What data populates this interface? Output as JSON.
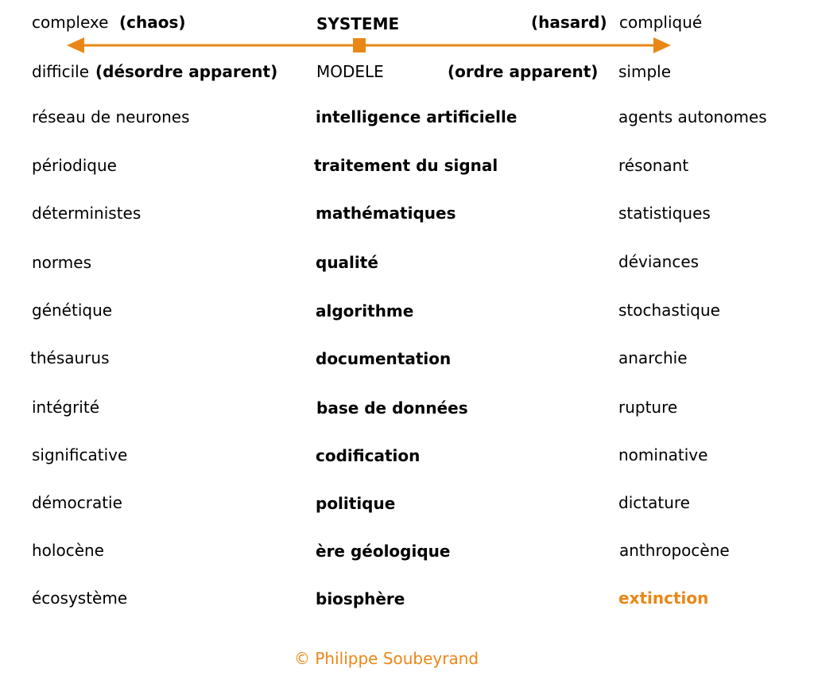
{
  "accent_color": "#e98716",
  "header": {
    "left_top_plain": "complexe",
    "left_top_bold": "(chaos)",
    "center_top": "SYSTEME",
    "right_top_bold": "(hasard)",
    "right_top_plain": "compliqué",
    "left_bottom_plain": "difficile",
    "left_bottom_bold": "(désordre apparent)",
    "center_bottom": "MODELE",
    "right_bottom_bold": "(ordre apparent)",
    "right_bottom_plain": "simple"
  },
  "rows": [
    {
      "left": "réseau de neurones",
      "center": "intelligence artificielle",
      "right": "agents autonomes"
    },
    {
      "left": "périodique",
      "center": "traitement du signal",
      "right": "résonant"
    },
    {
      "left": "déterministes",
      "center": "mathématiques",
      "right": "statistiques"
    },
    {
      "left": "normes",
      "center": "qualité",
      "right": "déviances"
    },
    {
      "left": "génétique",
      "center": "algorithme",
      "right": "stochastique"
    },
    {
      "left": "thésaurus",
      "center": "documentation",
      "right": "anarchie"
    },
    {
      "left": "intégrité",
      "center": "base de données",
      "right": "rupture"
    },
    {
      "left": "significative",
      "center": "codification",
      "right": "nominative"
    },
    {
      "left": "démocratie",
      "center": "politique",
      "right": "dictature"
    },
    {
      "left": "holocène",
      "center": "ère géologique",
      "right": "anthropocène"
    },
    {
      "left": "écosystème",
      "center": "biosphère",
      "right": "extinction"
    }
  ],
  "footer": {
    "copyright": "© Philippe Soubeyrand"
  }
}
